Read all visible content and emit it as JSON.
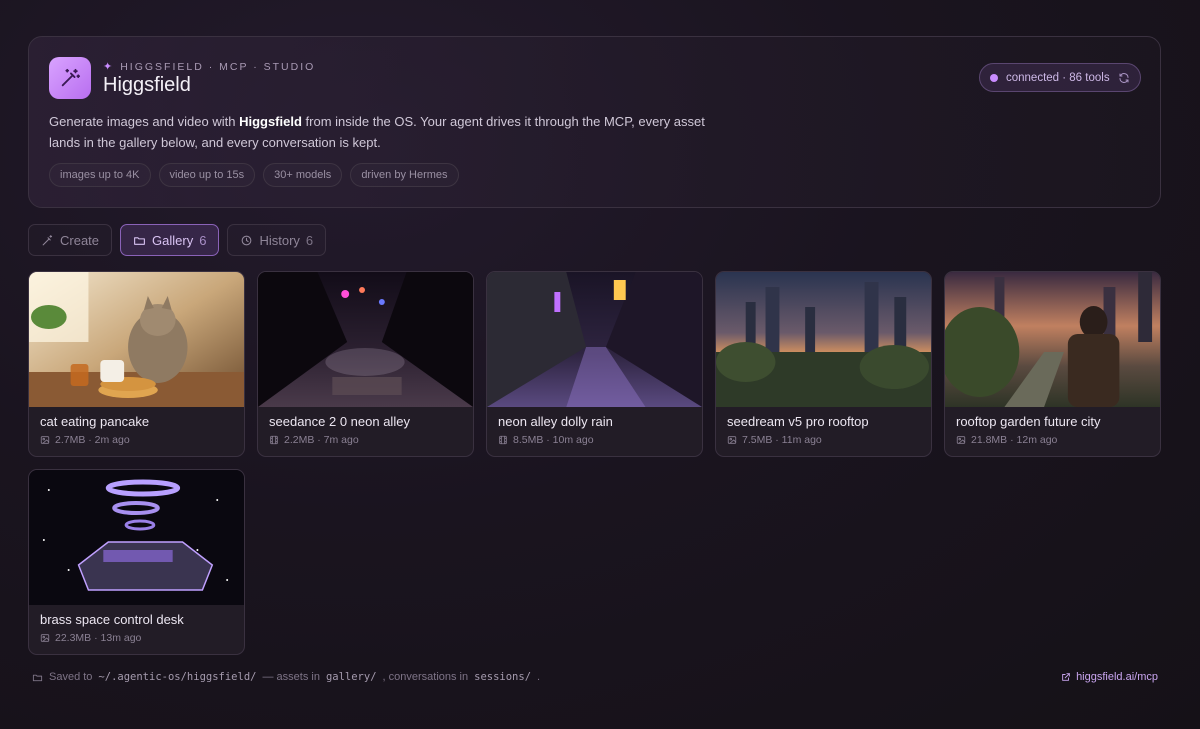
{
  "header": {
    "eyebrow": "HIGGSFIELD · MCP · STUDIO",
    "title": "Higgsfield",
    "status": "connected · 86 tools",
    "description": {
      "before": "Generate images and video with ",
      "bold": "Higgsfield",
      "after": " from inside the OS. Your agent drives it through the MCP, every asset lands in the gallery below, and every conversation is kept."
    },
    "chips": [
      "images up to 4K",
      "video up to 15s",
      "30+ models",
      "driven by Hermes"
    ],
    "accent_color": "#c98cff"
  },
  "tabs": [
    {
      "label": "Create",
      "count": ""
    },
    {
      "label": "Gallery",
      "count": "6"
    },
    {
      "label": "History",
      "count": "6"
    }
  ],
  "gallery": [
    {
      "title": "cat eating pancake",
      "meta": "2.7MB · 2m ago",
      "kind": "image-icon"
    },
    {
      "title": "seedance 2 0 neon alley",
      "meta": "2.2MB · 7m ago",
      "kind": "film-icon"
    },
    {
      "title": "neon alley dolly rain",
      "meta": "8.5MB · 10m ago",
      "kind": "film-icon"
    },
    {
      "title": "seedream v5 pro rooftop",
      "meta": "7.5MB · 11m ago",
      "kind": "image-icon"
    },
    {
      "title": "rooftop garden future city",
      "meta": "21.8MB · 12m ago",
      "kind": "image-icon"
    },
    {
      "title": "brass space control desk",
      "meta": "22.3MB · 13m ago",
      "kind": "image-icon"
    }
  ],
  "footer": {
    "saved_prefix": "Saved to",
    "path": "~/.agentic-os/higgsfield/",
    "assets_text": "— assets in",
    "assets_dir": "gallery/",
    "conv_text": ", conversations in",
    "conv_dir": "sessions/",
    "end": ".",
    "link": "higgsfield.ai/mcp"
  }
}
